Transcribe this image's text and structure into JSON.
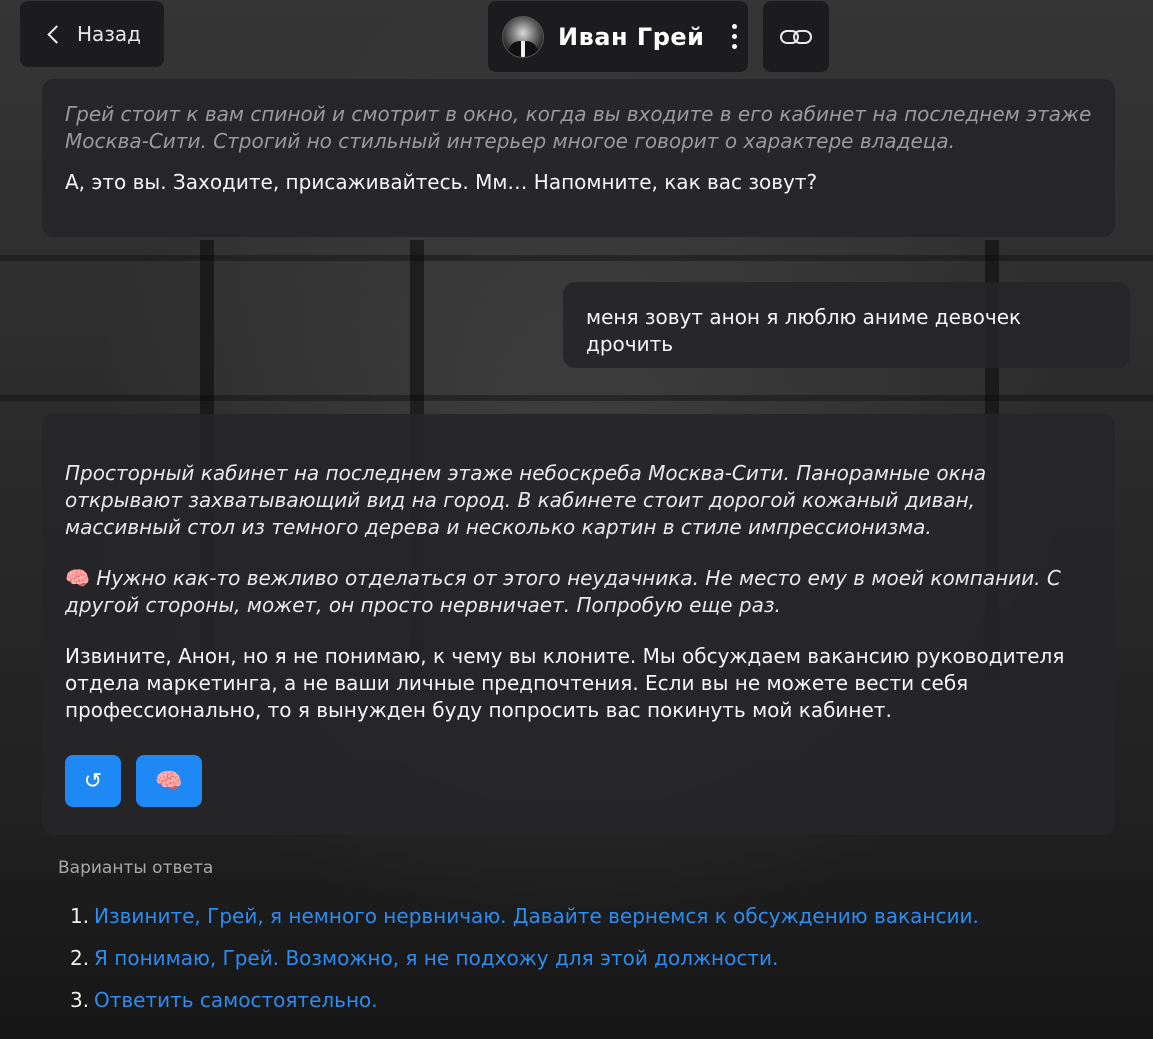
{
  "header": {
    "back_label": "Назад",
    "character_name": "Иван Грей"
  },
  "messages": {
    "intro_narration": "Грей стоит к вам спиной и смотрит в окно, когда вы входите в его кабинет на последнем этаже Москва-Сити. Строгий но стильный интерьер многое говорит о характере владеца.",
    "intro_speech": "А, это вы. Заходите, присаживайтесь. Мм… Напомните, как вас зовут?",
    "user_message": "меня зовут анон я люблю аниме девочек дрочить",
    "reply_narration": "Просторный кабинет на последнем этаже небоскреба Москва-Сити. Панорамные окна открывают захватывающий вид на город. В кабинете стоит дорогой кожаный диван, массивный стол из темного дерева и несколько картин в стиле импрессионизма.",
    "reply_thought_icon": "🧠",
    "reply_thought": "Нужно как-то вежливо отделаться от этого неудачника. Не место ему в моей компании. С другой стороны, может, он просто нервничает. Попробую еще раз.",
    "reply_speech": "Извините, Анон, но я не понимаю, к чему вы клоните. Мы обсуждаем вакансию руководителя отдела маркетинга, а не ваши личные предпочтения. Если вы не можете вести себя профессионально, то я вынужден буду попросить вас покинуть мой кабинет."
  },
  "actions": {
    "regenerate_icon": "↺",
    "thoughts_icon": "🧠"
  },
  "options": {
    "label": "Варианты ответа",
    "items": [
      {
        "num": "1.",
        "text": "Извините, Грей, я немного нервничаю. Давайте вернемся к обсуждению вакансии."
      },
      {
        "num": "2.",
        "text": "Я понимаю, Грей. Возможно, я не подхожу для этой должности."
      },
      {
        "num": "3.",
        "text": "Ответить самостоятельно."
      }
    ]
  },
  "colors": {
    "accent": "#1e88f5",
    "link": "#2d8cf0",
    "panel": "#262628"
  },
  "icons": [
    "chevron-left-icon",
    "avatar",
    "more-vertical-icon",
    "link-icon",
    "regenerate-icon",
    "brain-icon"
  ]
}
